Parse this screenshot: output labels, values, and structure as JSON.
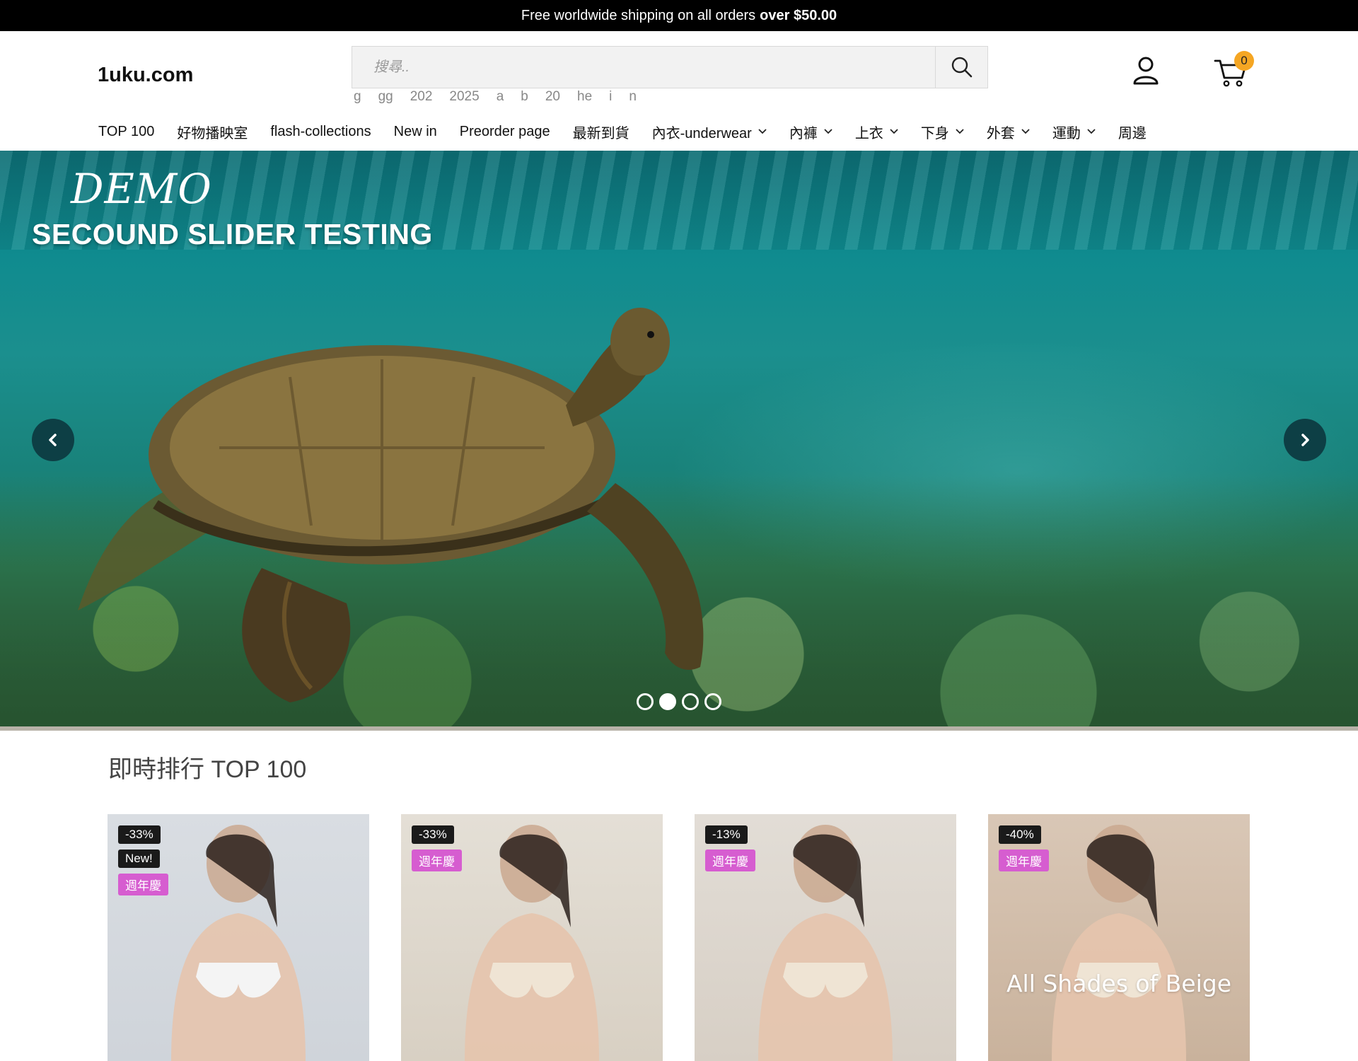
{
  "announcement": {
    "text": "Free worldwide shipping on all orders",
    "emphasis": "over $50.00"
  },
  "header": {
    "logo": "1uku.com",
    "search_placeholder": "搜尋..",
    "search_suggestions": [
      "g",
      "gg",
      "202",
      "2025",
      "a",
      "b",
      "20",
      "he",
      "i",
      "n"
    ],
    "cart_count": "0"
  },
  "nav": {
    "items": [
      {
        "label": "TOP 100",
        "dropdown": false
      },
      {
        "label": "好物播映室",
        "dropdown": false
      },
      {
        "label": "flash-collections",
        "dropdown": false
      },
      {
        "label": "New in",
        "dropdown": false
      },
      {
        "label": "Preorder page",
        "dropdown": false
      },
      {
        "label": "最新到貨",
        "dropdown": false
      },
      {
        "label": "內衣-underwear",
        "dropdown": true
      },
      {
        "label": "內褲",
        "dropdown": true
      },
      {
        "label": "上衣",
        "dropdown": true
      },
      {
        "label": "下身",
        "dropdown": true
      },
      {
        "label": "外套",
        "dropdown": true
      },
      {
        "label": "運動",
        "dropdown": true
      },
      {
        "label": "周邊",
        "dropdown": false
      }
    ]
  },
  "hero": {
    "script_text": "DEMO",
    "title": "SECOUND SLIDER TESTING",
    "slide_count": 4,
    "active_slide": 2
  },
  "section": {
    "title": "即時排行 TOP 100"
  },
  "products": [
    {
      "badges": [
        {
          "text": "-33%",
          "style": "dark"
        },
        {
          "text": "New!",
          "style": "dark"
        },
        {
          "text": "週年慶",
          "style": "pink"
        }
      ],
      "overlay": ""
    },
    {
      "badges": [
        {
          "text": "-33%",
          "style": "dark"
        },
        {
          "text": "週年慶",
          "style": "pink"
        }
      ],
      "overlay": ""
    },
    {
      "badges": [
        {
          "text": "-13%",
          "style": "dark"
        },
        {
          "text": "週年慶",
          "style": "pink"
        }
      ],
      "overlay": ""
    },
    {
      "badges": [
        {
          "text": "-40%",
          "style": "dark"
        },
        {
          "text": "週年慶",
          "style": "pink"
        }
      ],
      "overlay": "All Shades of Beige"
    }
  ],
  "colors": {
    "announce_bg": "#000000",
    "cart_badge": "#f5a623",
    "badge_dark": "#1a1a1a",
    "badge_pink": "#d65dd0",
    "hero_arrow": "#0d3f45"
  }
}
